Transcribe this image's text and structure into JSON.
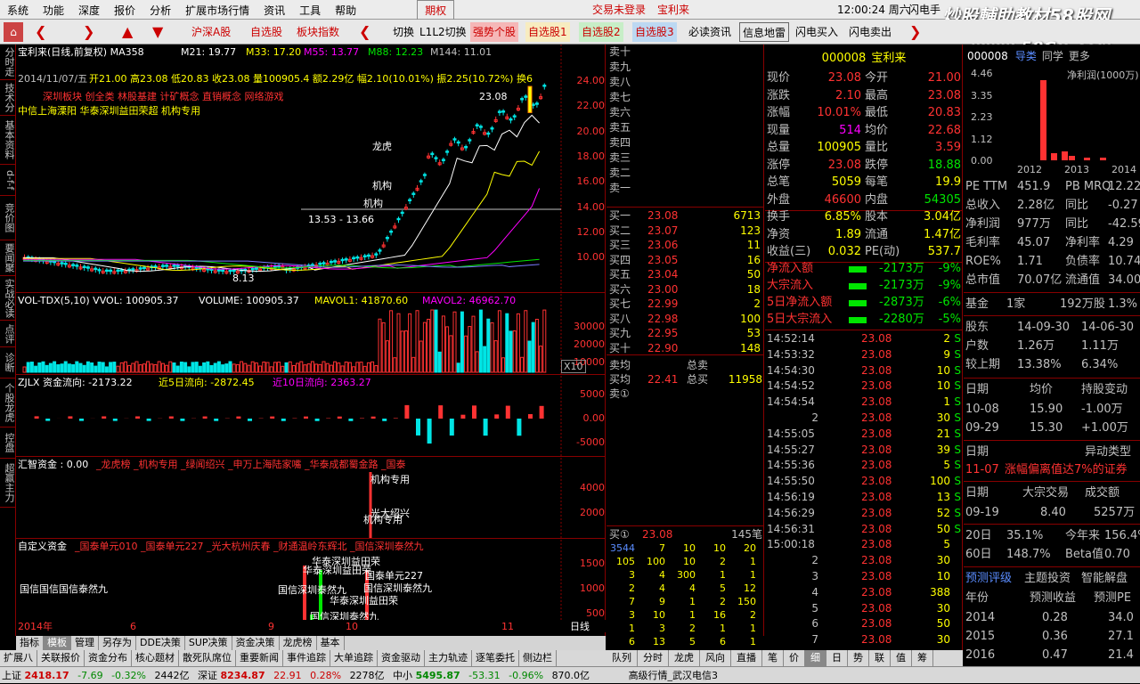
{
  "menu": [
    "系统",
    "功能",
    "深度",
    "报价",
    "分析",
    "扩展市场行情",
    "资讯",
    "工具",
    "帮助",
    "期权"
  ],
  "menu_login": "交易未登录",
  "menu_stock": "宝利来",
  "menu_time": "12:00:24 周六",
  "menu_flash": "闪电手",
  "watermark": "炒股輔助教材58股网",
  "watermark_url": "www.58Gu.com",
  "toolbar": {
    "hs_a": "沪深A股",
    "zxg": "自选股",
    "bkzs": "板块指数",
    "qh": "切换",
    "l1l2": "L1L2切换",
    "qsg": "强势个股",
    "zx1": "自选股1",
    "zx2": "自选股2",
    "zx3": "自选股3",
    "bdzx": "必读资讯",
    "xxdl": "信息地雷",
    "sdmr": "闪电买入",
    "sdmc": "闪电卖出"
  },
  "lefttabs": [
    "分时走势",
    "技术分析",
    "基本资料",
    "d-f-f",
    "竞价图",
    "要闻聚合",
    "实战必读",
    "点评",
    "诊断",
    "个股龙虎",
    "控盘度",
    "超赢主力"
  ],
  "chart": {
    "header": "宝利来(日线,前复权) MA358",
    "ma21": "M21: 19.77",
    "ma33": "M33: 17.20",
    "ma55": "M55: 13.77",
    "ma88": "M88: 12.23",
    "ma144": "M144: 11.01",
    "ohlc_date": "2014/11/07/五",
    "ohlc": "开21.00 高23.08 低20.83 收23.08 量100905.4 额2.29亿 幅2.10(10.01%) 振2.25(10.72%) 换6",
    "concepts": "深圳板块 创全类 林股基建 计矿概念 直销概念 网络游戏",
    "lhb": "中信上海溧阳 华泰深圳益田荣超 机构专用",
    "hi": "23.08",
    "lo": "8.13",
    "range": "13.53 - 13.66",
    "lbl_lh": "龙虎",
    "lbl_jg1": "机构",
    "lbl_jg2": "机构",
    "y_main": [
      "24.00",
      "22.00",
      "20.00",
      "18.00",
      "16.00",
      "14.00",
      "12.00",
      "10.00"
    ],
    "vol_header": "VOL-TDX(5,10) VVOL: 100905.37",
    "vol_v": "VOLUME: 100905.37",
    "mavol1": "MAVOL1: 41870.60",
    "mavol2": "MAVOL2: 46962.70",
    "y_vol": [
      "30000",
      "20000",
      "10000"
    ],
    "x10": "X10",
    "zjlx": "ZJLX 资金流向: -2173.22",
    "zjlx5": "近5日流向: -2872.45",
    "zjlx10": "近10日流向: 2363.27",
    "y_zj": [
      "5000",
      "0.00",
      "-5000"
    ],
    "hz": "汇智资金 : 0.00",
    "hz_items": "_龙虎榜  _机构专用  _绿闻绍兴  _申万上海陆家嘴  _华泰成都蜀金路  _国泰",
    "hz_lbl1": "机构专用",
    "hz_lbl2": "机构专用",
    "hz_lbl3": "光大绍兴",
    "y_hz": [
      "4000",
      "2000"
    ],
    "zdy": "自定义资金",
    "zdy_items": "_国泰单元010  _国泰单元227  _光大杭州庆春  _财通温岭东辉北  _国信深圳泰然九",
    "zdy_l1": "国信国信国信泰然九",
    "zdy_l2": "华泰深圳益田荣",
    "zdy_l3": "华泰深圳益田荣",
    "zdy_l4": "国泰单元227",
    "zdy_l5": "国信深圳泰然九",
    "zdy_l6": "国信深圳泰然九",
    "zdy_l7": "华泰深圳益田荣",
    "zdy_l8": "国信深圳泰然九",
    "y_zdy": [
      "1500",
      "1000",
      "500"
    ],
    "x_axis": [
      "2014年",
      "6",
      "9",
      "10",
      "11"
    ],
    "x_unit": "日线"
  },
  "chart_tabs": [
    "指标",
    "模板",
    "管理",
    "另存为",
    "DDE决策",
    "SUP决策",
    "资金决策",
    "龙虎榜",
    "基本"
  ],
  "bottom_tabs": [
    "扩展八",
    "关联报价",
    "资金分布",
    "核心题材",
    "散死队席位",
    "重要新闻",
    "事件追踪",
    "大单追踪",
    "资金驱动",
    "主力轨迹",
    "逐笔委托",
    "侧边栏"
  ],
  "orderbook": {
    "sells": [
      {
        "l": "卖十"
      },
      {
        "l": "卖九"
      },
      {
        "l": "卖八"
      },
      {
        "l": "卖七"
      },
      {
        "l": "卖六"
      },
      {
        "l": "卖五"
      },
      {
        "l": "卖四"
      },
      {
        "l": "卖三"
      },
      {
        "l": "卖二"
      },
      {
        "l": "卖一"
      }
    ],
    "buys": [
      {
        "l": "买一",
        "p": "23.08",
        "v": "6713"
      },
      {
        "l": "买二",
        "p": "23.07",
        "v": "123"
      },
      {
        "l": "买三",
        "p": "23.06",
        "v": "11"
      },
      {
        "l": "买四",
        "p": "23.05",
        "v": "16"
      },
      {
        "l": "买五",
        "p": "23.04",
        "v": "50"
      },
      {
        "l": "买六",
        "p": "23.00",
        "v": "18"
      },
      {
        "l": "买七",
        "p": "22.99",
        "v": "2"
      },
      {
        "l": "买八",
        "p": "22.98",
        "v": "100"
      },
      {
        "l": "买九",
        "p": "22.95",
        "v": "53"
      },
      {
        "l": "买十",
        "p": "22.90",
        "v": "148"
      }
    ],
    "sell_avg": "卖均",
    "buy_avg": "买均",
    "buy_avg_v": "22.41",
    "total_sell": "总卖",
    "total_buy": "总买",
    "total_buy_v": "11958",
    "sell1_mark": "卖①",
    "buy1_row": "买①",
    "buy1_price": "23.08",
    "buy1_cnt": "145笔",
    "queue": [
      [
        "3544",
        "7",
        "10",
        "10",
        "20"
      ],
      [
        "105",
        "100",
        "10",
        "2",
        "1"
      ],
      [
        "3",
        "4",
        "300",
        "1",
        "1"
      ],
      [
        "2",
        "4",
        "4",
        "5",
        "12"
      ],
      [
        "7",
        "9",
        "1",
        "2",
        "150"
      ],
      [
        "3",
        "10",
        "1",
        "16",
        "2"
      ],
      [
        "1",
        "3",
        "2",
        "1",
        "1"
      ],
      [
        "6",
        "13",
        "5",
        "6",
        "1"
      ]
    ]
  },
  "quote": {
    "code": "000008",
    "name": "宝利来",
    "rows": [
      [
        "现价",
        "23.08",
        "今开",
        "21.00"
      ],
      [
        "涨跌",
        "2.10",
        "最高",
        "23.08"
      ],
      [
        "涨幅",
        "10.01%",
        "最低",
        "20.83"
      ],
      [
        "现量",
        "514",
        "均价",
        "22.68"
      ],
      [
        "总量",
        "100905",
        "量比",
        "3.59"
      ],
      [
        "涨停",
        "23.08",
        "跌停",
        "18.88"
      ],
      [
        "总笔",
        "5059",
        "每笔",
        "19.9"
      ],
      [
        "外盘",
        "46600",
        "内盘",
        "54305"
      ]
    ],
    "rows2": [
      [
        "换手",
        "6.85%",
        "股本",
        "3.04亿"
      ],
      [
        "净资",
        "1.89",
        "流通",
        "1.47亿"
      ],
      [
        "收益(三)",
        "0.032",
        "PE(动)",
        "537.7"
      ]
    ],
    "flows": [
      [
        "净流入额",
        "-2173万",
        "-9%"
      ],
      [
        "大宗流入",
        "-2173万",
        "-9%"
      ],
      [
        "5日净流入额",
        "-2873万",
        "-6%"
      ],
      [
        "5日大宗流入",
        "-2280万",
        "-5%"
      ]
    ],
    "ticks": [
      [
        "14:52:14",
        "23.08",
        "2",
        "S"
      ],
      [
        "14:53:32",
        "23.08",
        "9",
        "S"
      ],
      [
        "14:54:30",
        "23.08",
        "10",
        "S"
      ],
      [
        "14:54:52",
        "23.08",
        "10",
        "S"
      ],
      [
        "14:54:54",
        "23.08",
        "1",
        "S"
      ],
      [
        "2",
        "23.08",
        "30",
        "S"
      ],
      [
        "14:55:05",
        "23.08",
        "21",
        "S"
      ],
      [
        "14:55:27",
        "23.08",
        "39",
        "S"
      ],
      [
        "14:55:36",
        "23.08",
        "5",
        "S"
      ],
      [
        "14:55:50",
        "23.08",
        "100",
        "S"
      ],
      [
        "14:56:19",
        "23.08",
        "13",
        "S"
      ],
      [
        "14:56:29",
        "23.08",
        "52",
        "S"
      ],
      [
        "14:56:31",
        "23.08",
        "50",
        "S"
      ],
      [
        "15:00:18",
        "23.08",
        "5",
        ""
      ],
      [
        "2",
        "23.08",
        "30",
        ""
      ],
      [
        "3",
        "23.08",
        "10",
        ""
      ],
      [
        "4",
        "23.08",
        "388",
        ""
      ],
      [
        "5",
        "23.08",
        "30",
        ""
      ],
      [
        "6",
        "23.08",
        "50",
        ""
      ],
      [
        "7",
        "23.08",
        "30",
        ""
      ]
    ]
  },
  "right_tabs": [
    "队列",
    "分时",
    "龙虎",
    "风向",
    "直播",
    "笔",
    "价",
    "细",
    "日",
    "势",
    "联",
    "值",
    "筹"
  ],
  "far": {
    "code": "000008",
    "tab1": "导类",
    "tab2": "同学",
    "tab3": "更多",
    "chart_title": "净利润(1000万)",
    "y": [
      "4.46",
      "3.35",
      "2.23",
      "1.12",
      "0.00"
    ],
    "x": [
      "2012",
      "2013",
      "2014"
    ],
    "bars": [
      {
        "v": 4.1,
        "c": "#ff3232"
      },
      {
        "v": 0.35,
        "c": "#ff3232"
      },
      {
        "v": 0.45,
        "c": "#ff3232"
      },
      {
        "v": 0.25,
        "c": "#ff3232"
      },
      {
        "v": 0.15,
        "c": "#ff3232"
      },
      {
        "v": 0.15,
        "c": "#ff3232"
      }
    ],
    "fin": [
      [
        "PE TTM",
        "451.9",
        "PB MRQ",
        "12.22"
      ],
      [
        "总收入",
        "2.28亿",
        "同比",
        "-0.27"
      ],
      [
        "净利润",
        "977万",
        "同比",
        "-42.59"
      ],
      [
        "毛利率",
        "45.07",
        "净利率",
        "4.29"
      ],
      [
        "ROE%",
        "1.71",
        "负债率",
        "10.74"
      ],
      [
        "总市值",
        "70.07亿",
        "流通值",
        "34.00亿"
      ]
    ],
    "fund": [
      "基金",
      "1家",
      "192万股",
      "1.3%"
    ],
    "holder": [
      [
        "股东",
        "14-09-30",
        "14-06-30"
      ],
      [
        "户数",
        "1.26万",
        "1.11万"
      ],
      [
        "较上期",
        "13.38%",
        "6.34%"
      ]
    ],
    "hz_head": [
      "日期",
      "均价",
      "持股变动"
    ],
    "hz": [
      [
        "10-08",
        "15.90",
        "-1.00万"
      ],
      [
        "09-29",
        "15.30",
        "+1.00万"
      ]
    ],
    "yd_head": [
      "日期",
      "异动类型"
    ],
    "yd": [
      "11-07",
      "涨幅偏离值达7%的证券"
    ],
    "dz_head": [
      "日期",
      "大宗交易",
      "成交额"
    ],
    "dz": [
      "09-19",
      "8.40",
      "5257万"
    ],
    "perf": [
      [
        "20日",
        "35.1%",
        "今年来",
        "156.4%"
      ],
      [
        "60日",
        "148.7%",
        "Beta值",
        "0.70"
      ]
    ],
    "fc_tabs": [
      "预测评级",
      "主题投资",
      "智能解盘"
    ],
    "fc_head": [
      "年份",
      "预测收益",
      "预测PE"
    ],
    "fc": [
      [
        "2014",
        "0.28",
        "34.0"
      ],
      [
        "2015",
        "0.36",
        "27.1"
      ],
      [
        "2016",
        "0.47",
        "21.4"
      ]
    ]
  },
  "status": {
    "sh": "上证",
    "sh_v": "2418.17",
    "sh_c": "-7.69",
    "sh_p": "-0.32%",
    "sh_a": "2442亿",
    "sz": "深证",
    "sz_v": "8234.87",
    "sz_c": "22.91",
    "sz_p": "0.28%",
    "sz_a": "2278亿",
    "zx": "中小",
    "zx_v": "5495.87",
    "zx_c": "-53.31",
    "zx_p": "-0.96%",
    "zx_a": "870.0亿",
    "srv": "高级行情_武汉电信3"
  },
  "colors": {
    "up": "#ff3232",
    "down": "#00e5e5",
    "bg": "#000000",
    "grid": "#800000"
  }
}
